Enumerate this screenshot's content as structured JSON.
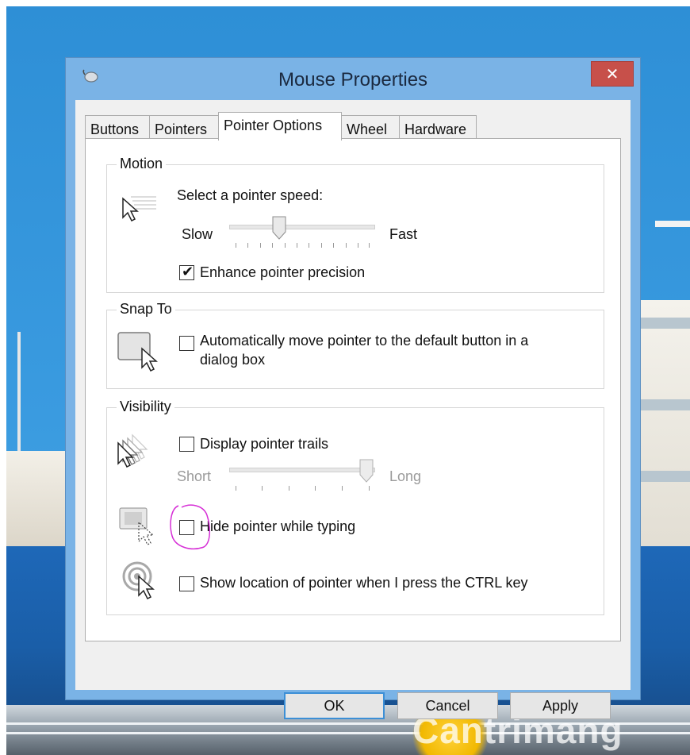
{
  "window": {
    "title": "Mouse Properties",
    "close_glyph": "✕"
  },
  "tabs": [
    {
      "label": "Buttons"
    },
    {
      "label": "Pointers"
    },
    {
      "label": "Pointer Options"
    },
    {
      "label": "Wheel"
    },
    {
      "label": "Hardware"
    }
  ],
  "active_tab": "Pointer Options",
  "motion": {
    "group_label": "Motion",
    "speed_label": "Select a pointer speed:",
    "slow_label": "Slow",
    "fast_label": "Fast",
    "speed_level": 0.33,
    "precision_label": "Enhance pointer precision",
    "precision_checked": true
  },
  "snap_to": {
    "group_label": "Snap To",
    "auto_move_label": "Automatically move pointer to the default button in a",
    "auto_move_label_2": "dialog box",
    "auto_move_checked": false
  },
  "visibility": {
    "group_label": "Visibility",
    "trails_label": "Display pointer trails",
    "trails_checked": false,
    "short_label": "Short",
    "long_label": "Long",
    "trails_level": 1.0,
    "hide_label": "Hide pointer while typing",
    "hide_checked": false,
    "ctrl_label": "Show location of pointer when I press the CTRL key",
    "ctrl_checked": false
  },
  "buttons": {
    "ok": "OK",
    "cancel": "Cancel",
    "apply": "Apply"
  },
  "watermark": "Cantrimang",
  "colors": {
    "annotation": "#d62fd6",
    "close": "#c7504a",
    "accent": "#3c8fd6"
  }
}
